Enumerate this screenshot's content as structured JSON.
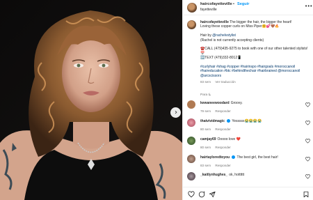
{
  "post": {
    "username": "haircofayetteville",
    "follow_label": "Seguir",
    "location": "fayetteville",
    "more_label": "•••"
  },
  "caption": {
    "username": "haircofayetteville",
    "line1": "The bigger the hair, the bigger the heart!",
    "line2": "Loving these copper curls on Miss Piper🤗💕🤎🔥",
    "hair_by_prefix": "Hair by ",
    "hair_by_link": "@rachelvstylist",
    "not_accepting": "(Rachel is not currently accepting clients)",
    "call_line": "☎️CALL (479)435-9275 to book with one of our other talented stylists!📅",
    "text_line": "🆗TEXT (479)332-8012📱",
    "hashtags": "#curlyhair #shag #copper #hairinspo #hairgoals #moroccanoil #haireducation #btc #behindthechair #hairbrained @moroccanoil @arcscissors",
    "time": "83 sem",
    "translation": "Ver traducción"
  },
  "comments": {
    "label": "Para ti",
    "chevron": "⌄",
    "reply_label": "Responder",
    "items": [
      {
        "username": "kewaneewoodard",
        "text": "Groovy.",
        "time": "79 sem",
        "avatar": "#b07a52"
      },
      {
        "username": "thatvividmagic",
        "text": "Yesssss😭😭😭😭",
        "time": "80 sem",
        "avatar": "#c46a7a",
        "verified": true
      },
      {
        "username": "camjay69",
        "text": "Ooooo love ❤️",
        "time": "80 sem",
        "avatar": "#4a6b3a"
      },
      {
        "username": "hairtayloredtoyou",
        "text": "The best girl, the best hair!",
        "time": "83 sem",
        "avatar": "#8a6a5a",
        "verified": true
      },
      {
        "username": "_kaitlynhughes_",
        "text": "ok, hotttttt",
        "time": "83 sem",
        "avatar": "#6a5a62"
      }
    ]
  },
  "colors": {
    "link": "#00376b",
    "follow": "#0095f6",
    "muted": "#737373",
    "text": "#262626"
  }
}
